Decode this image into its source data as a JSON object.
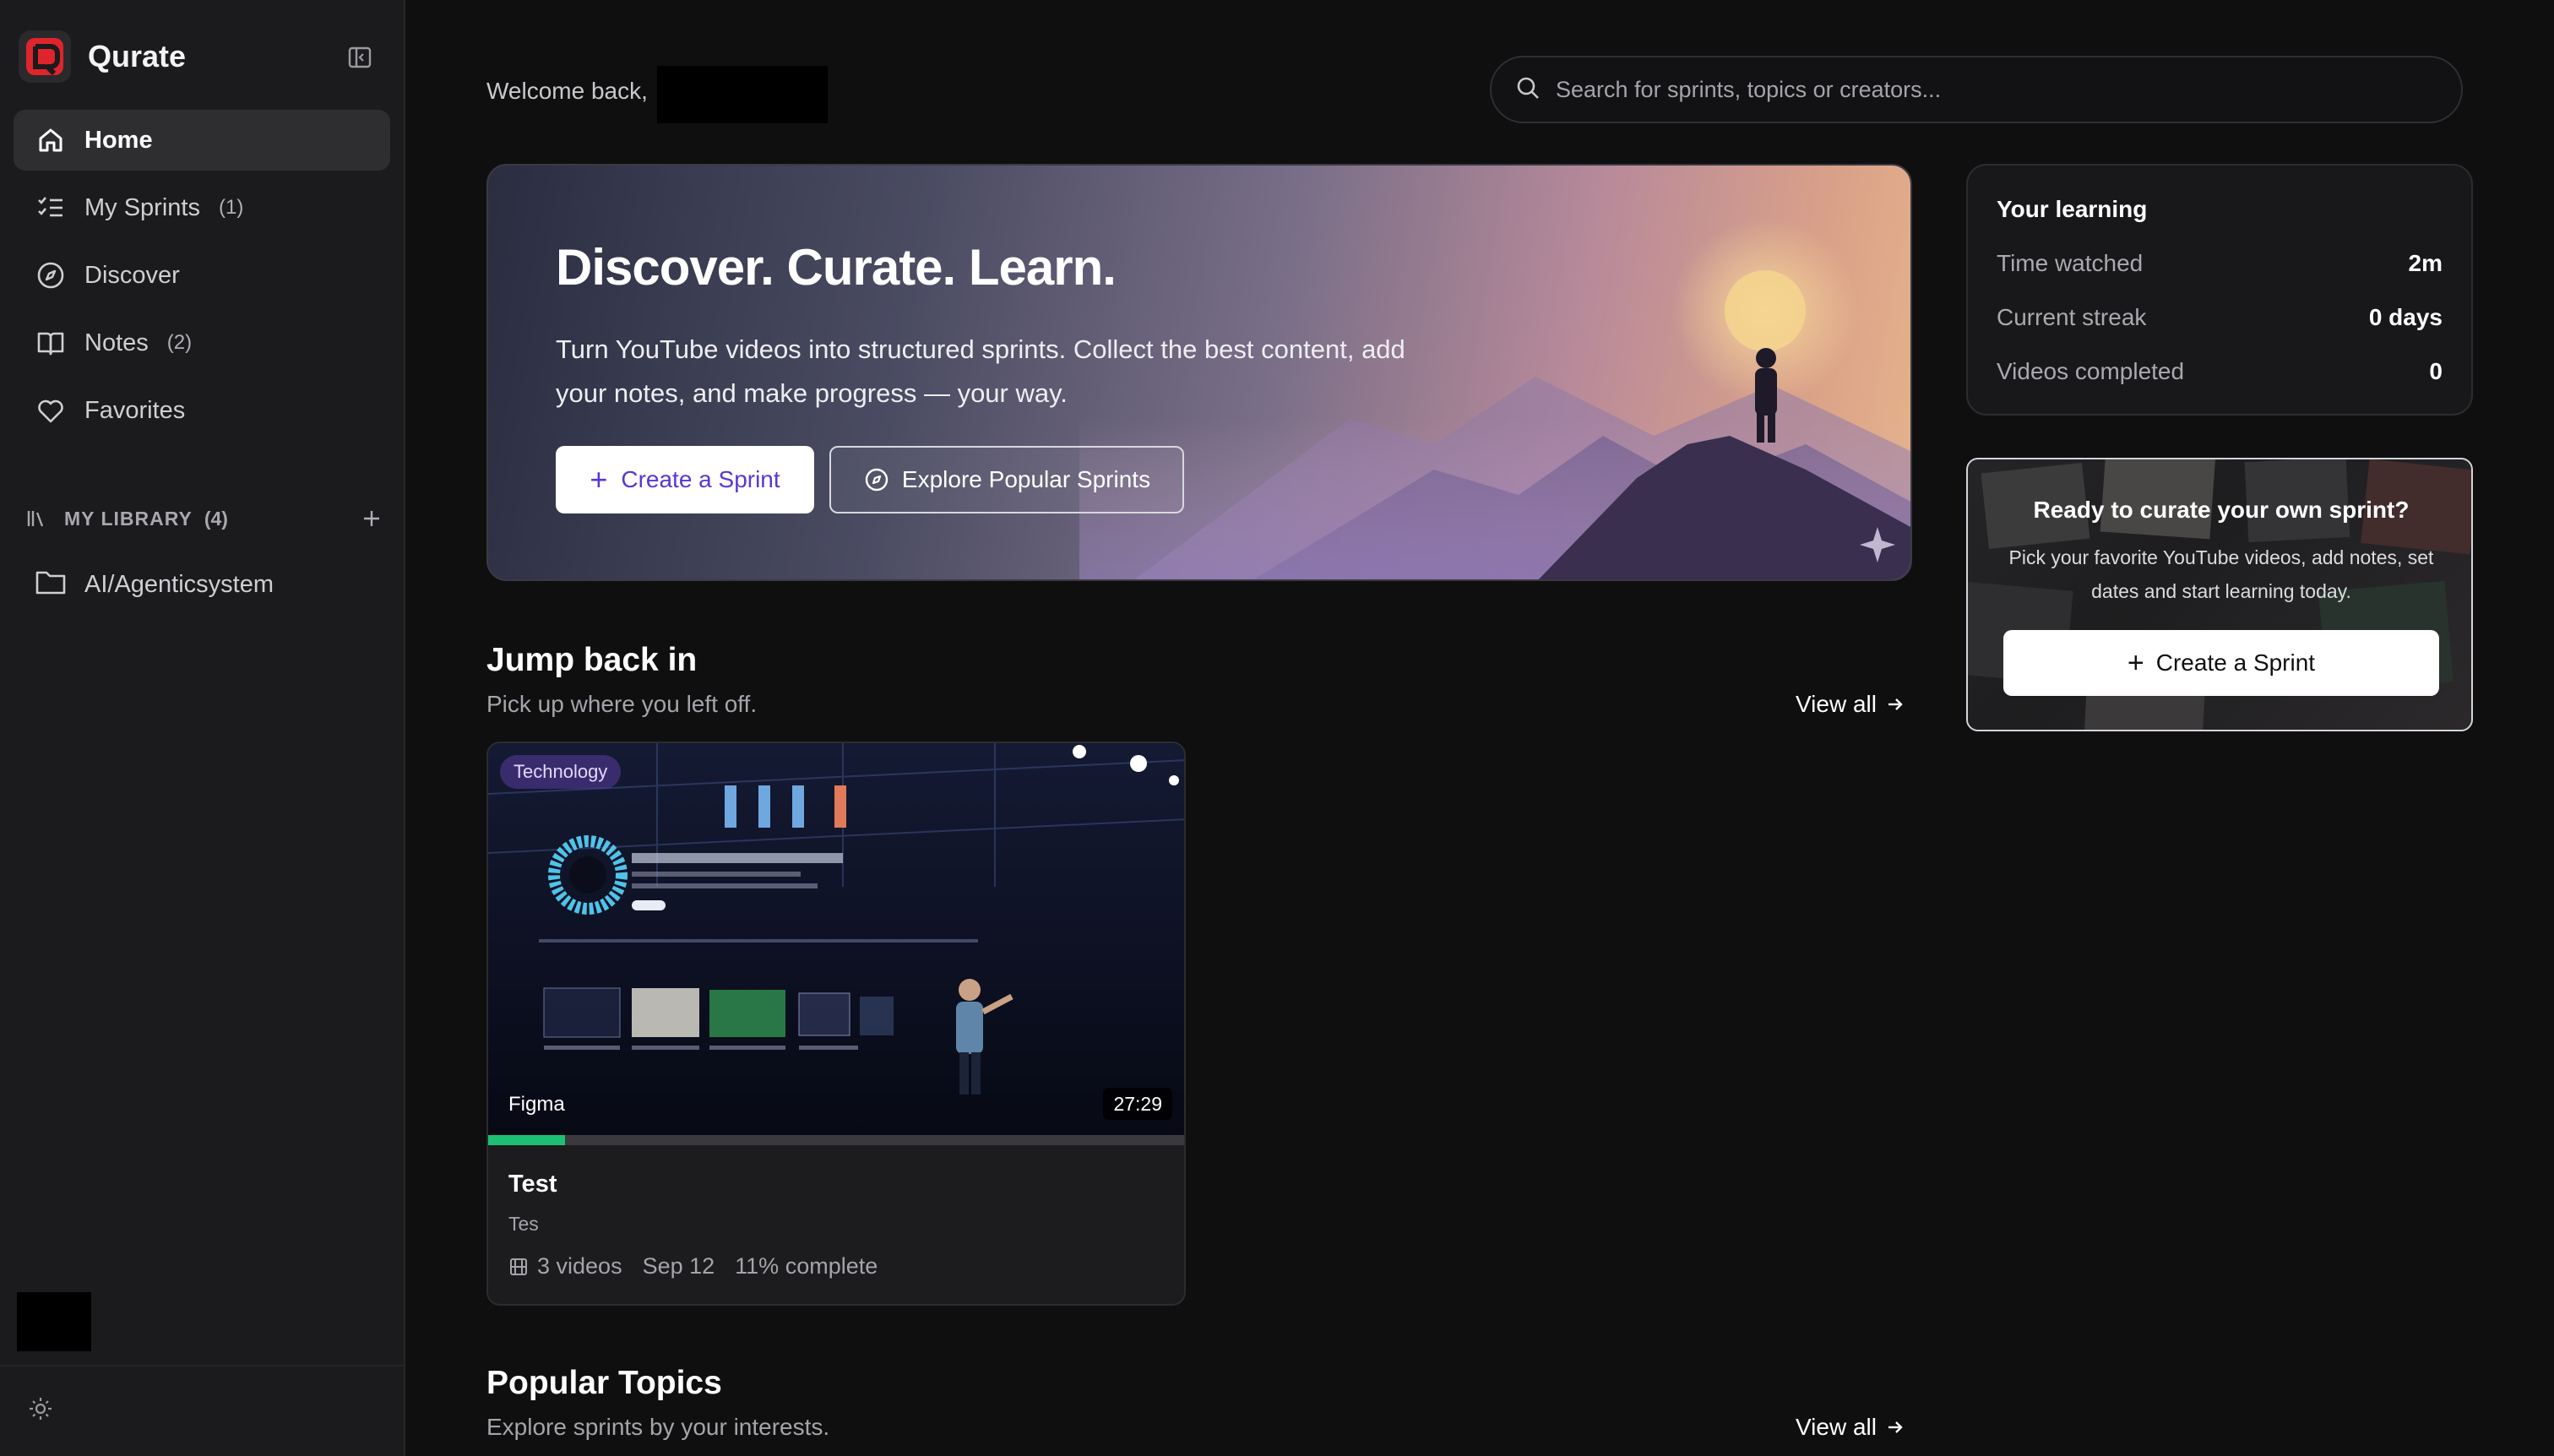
{
  "app": {
    "name": "Qurate"
  },
  "sidebar": {
    "items": [
      {
        "label": "Home",
        "icon": "home-icon",
        "count": ""
      },
      {
        "label": "My Sprints",
        "icon": "list-check-icon",
        "count": "(1)"
      },
      {
        "label": "Discover",
        "icon": "compass-icon",
        "count": ""
      },
      {
        "label": "Notes",
        "icon": "book-icon",
        "count": "(2)"
      },
      {
        "label": "Favorites",
        "icon": "heart-icon",
        "count": ""
      }
    ],
    "library": {
      "title": "MY LIBRARY",
      "count": "(4)",
      "folders": [
        {
          "label": "AI/Agenticsystem"
        }
      ]
    }
  },
  "header": {
    "welcome": "Welcome back,",
    "search_placeholder": "Search for sprints, topics or creators..."
  },
  "hero": {
    "title": "Discover. Curate. Learn.",
    "subtitle": "Turn YouTube videos into structured sprints. Collect the best content, add your notes, and make progress — your way.",
    "primary_label": "Create a Sprint",
    "secondary_label": "Explore Popular Sprints"
  },
  "learning": {
    "title": "Your learning",
    "rows": [
      {
        "k": "Time watched",
        "v": "2m"
      },
      {
        "k": "Current streak",
        "v": "0 days"
      },
      {
        "k": "Videos completed",
        "v": "0"
      }
    ]
  },
  "cta": {
    "title": "Ready to curate your own sprint?",
    "subtitle": "Pick your favorite YouTube videos, add notes, set dates and start learning today.",
    "button": "Create a Sprint"
  },
  "jump": {
    "title": "Jump back in",
    "subtitle": "Pick up where you left off.",
    "view_all": "View all",
    "card": {
      "tag": "Technology",
      "thumb_label": "Figma",
      "duration": "27:29",
      "progress": 0.11,
      "title": "Test",
      "description": "Tes",
      "videos": "3 videos",
      "date": "Sep 12",
      "complete": "11% complete"
    }
  },
  "topics": {
    "title": "Popular Topics",
    "subtitle": "Explore sprints by your interests.",
    "view_all": "View all"
  },
  "colors": {
    "accent": "#5b35d5",
    "progress": "#1fbf73",
    "brand_red": "#e0242c"
  }
}
